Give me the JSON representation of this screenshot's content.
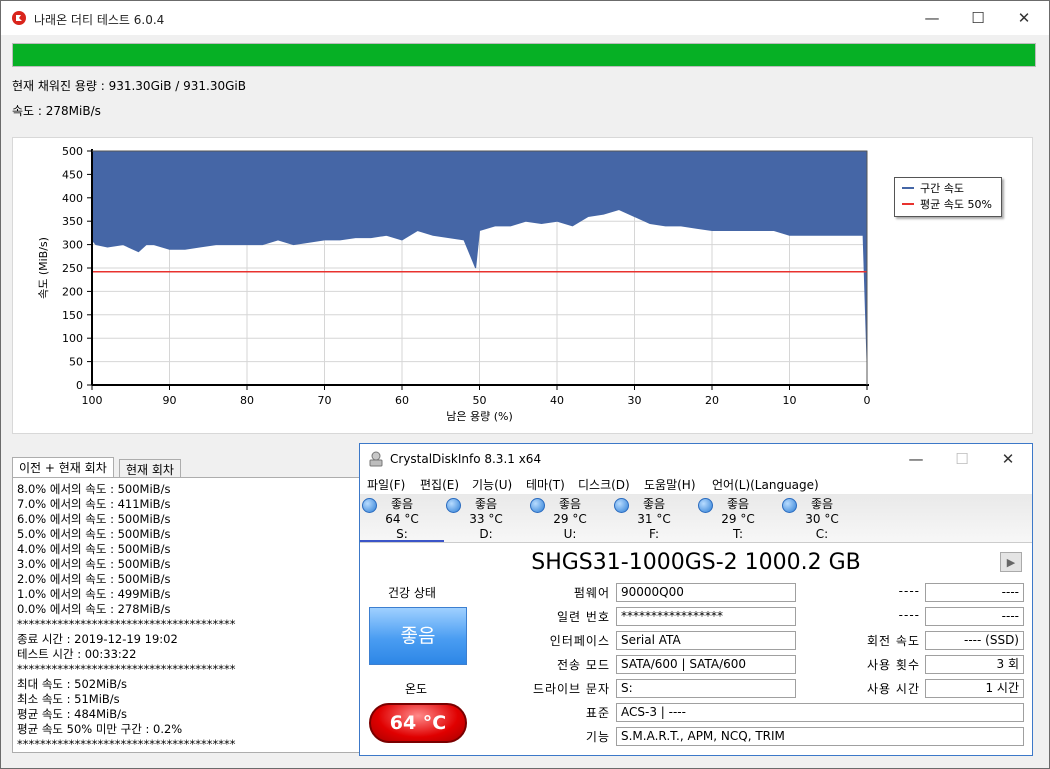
{
  "main_window": {
    "title": "나래온 더티 테스트 6.0.4",
    "minimize": "—",
    "maximize": "☐",
    "close": "✕",
    "fill_status": "현재 채워진 용량 : 931.30GiB / 931.30GiB",
    "speed_status": "속도 : 278MiB/s",
    "progress_percent": 100,
    "tabs": [
      "이전 + 현재 회차",
      "현재 회차"
    ],
    "log_lines": [
      "8.0% 에서의 속도 : 500MiB/s",
      "7.0% 에서의 속도 : 411MiB/s",
      "6.0% 에서의 속도 : 500MiB/s",
      "5.0% 에서의 속도 : 500MiB/s",
      "4.0% 에서의 속도 : 500MiB/s",
      "3.0% 에서의 속도 : 500MiB/s",
      "2.0% 에서의 속도 : 500MiB/s",
      "1.0% 에서의 속도 : 499MiB/s",
      "0.0% 에서의 속도 : 278MiB/s",
      "**************************************",
      "종료 시간 : 2019-12-19 19:02",
      "테스트 시간 : 00:33:22",
      "**************************************",
      "최대 속도 : 502MiB/s",
      "최소 속도 : 51MiB/s",
      "평균 속도 : 484MiB/s",
      "평균 속도 50% 미만 구간 : 0.2%",
      "**************************************"
    ]
  },
  "chart_data": {
    "type": "area",
    "xlabel": "남은 용량 (%)",
    "ylabel": "속도 (MiB/s)",
    "xlim": [
      100,
      0
    ],
    "ylim": [
      0,
      500
    ],
    "x_ticks": [
      "100",
      "90",
      "80",
      "70",
      "60",
      "50",
      "40",
      "30",
      "20",
      "10",
      "0"
    ],
    "y_ticks": [
      "500",
      "450",
      "400",
      "350",
      "300",
      "250",
      "200",
      "150",
      "100",
      "50",
      "0"
    ],
    "series": [
      {
        "name": "구간 속도",
        "color": "#4566a6",
        "x": [
          100,
          99.5,
          98,
          96,
          94,
          93,
          92,
          90,
          88,
          86,
          84,
          82,
          80,
          78,
          76,
          74,
          72,
          70,
          68,
          66,
          64,
          62,
          60,
          58,
          56,
          52,
          50.5,
          50,
          48,
          46,
          44,
          42,
          40,
          38,
          36,
          34,
          32,
          30,
          28,
          26,
          24,
          22,
          20,
          18,
          16,
          14,
          12,
          10,
          8,
          6,
          4,
          2,
          0.5,
          0
        ],
        "values": [
          310,
          300,
          295,
          300,
          285,
          300,
          300,
          290,
          290,
          295,
          300,
          300,
          300,
          300,
          310,
          300,
          305,
          310,
          310,
          315,
          315,
          320,
          310,
          330,
          320,
          310,
          250,
          330,
          340,
          340,
          350,
          345,
          350,
          340,
          360,
          365,
          375,
          360,
          345,
          340,
          340,
          335,
          330,
          330,
          330,
          330,
          330,
          320,
          320,
          320,
          320,
          320,
          320,
          51
        ]
      },
      {
        "name": "평균 속도 50%",
        "color": "#e8322e",
        "x": [
          100,
          0
        ],
        "values": [
          242,
          242
        ]
      }
    ],
    "legend_position": "right",
    "grid": true
  },
  "cdi": {
    "title": "CrystalDiskInfo 8.3.1 x64",
    "minimize": "—",
    "maximize": "☐",
    "close": "✕",
    "menu": [
      "파일(F)",
      "편집(E)",
      "기능(U)",
      "테마(T)",
      "디스크(D)",
      "도움말(H)",
      "언어(L)(Language)"
    ],
    "drives": [
      {
        "status": "좋음",
        "temp": "64 °C",
        "letter": "S:"
      },
      {
        "status": "좋음",
        "temp": "33 °C",
        "letter": "D:"
      },
      {
        "status": "좋음",
        "temp": "29 °C",
        "letter": "U:"
      },
      {
        "status": "좋음",
        "temp": "31 °C",
        "letter": "F:"
      },
      {
        "status": "좋음",
        "temp": "29 °C",
        "letter": "T:"
      },
      {
        "status": "좋음",
        "temp": "30 °C",
        "letter": "C:"
      }
    ],
    "disk_name": "SHGS31-1000GS-2 1000.2 GB",
    "health_label": "건강 상태",
    "health_value": "좋음",
    "temp_label": "온도",
    "temp_value": "64 °C",
    "rows": {
      "firmware": {
        "label": "펌웨어",
        "value": "90000Q00"
      },
      "serial": {
        "label": "일련 번호",
        "value": "*****************"
      },
      "interface": {
        "label": "인터페이스",
        "value": "Serial ATA"
      },
      "transfer": {
        "label": "전송 모드",
        "value": "SATA/600 | SATA/600"
      },
      "drive_letter": {
        "label": "드라이브 문자",
        "value": "S:"
      },
      "standard": {
        "label": "표준",
        "value": "ACS-3 | ----"
      },
      "features": {
        "label": "기능",
        "value": "S.M.A.R.T., APM, NCQ, TRIM"
      }
    },
    "right_rows": {
      "blank1": {
        "label": "----",
        "value": "----"
      },
      "blank2": {
        "label": "----",
        "value": "----"
      },
      "rotation": {
        "label": "회전 속도",
        "value": "---- (SSD)"
      },
      "power_count": {
        "label": "사용 횟수",
        "value": "3 회"
      },
      "power_hours": {
        "label": "사용 시간",
        "value": "1 시간"
      }
    }
  }
}
